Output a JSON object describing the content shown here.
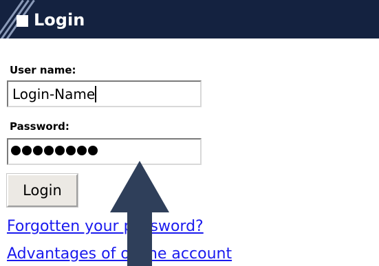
{
  "login_panel": {
    "title": "Login",
    "username": {
      "label": "User name:",
      "value": "Login-Name"
    },
    "password": {
      "label": "Password:",
      "masked_chars": 8
    },
    "login_button_label": "Login",
    "links": [
      "Forgotten your password?",
      "Advantages of online account"
    ]
  },
  "colors": {
    "title_bar": "#142240",
    "link": "#1a1aee",
    "arrow": "#2f3f5a"
  },
  "icons": {
    "title_marker": "square-icon",
    "pointer": "up-arrow-icon"
  }
}
